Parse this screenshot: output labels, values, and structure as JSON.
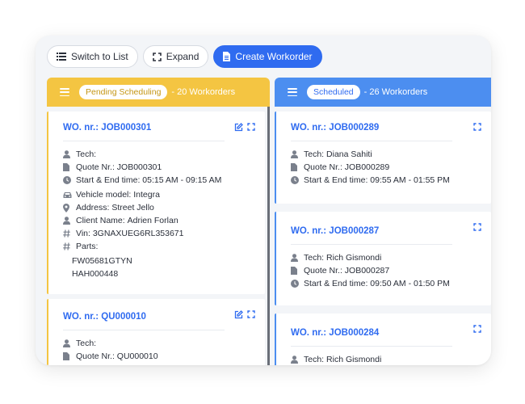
{
  "toolbar": {
    "switch_label": "Switch to List",
    "expand_label": "Expand",
    "create_label": "Create Workorder"
  },
  "columns": [
    {
      "status": "Pending Scheduling",
      "count": "- 20 Workorders",
      "color": "#f4c542",
      "cards": [
        {
          "wo_label": "WO. nr.:",
          "wo_number": "JOB000301",
          "tech": "Tech:",
          "quote": "Quote Nr.: JOB000301",
          "time": "Start & End time: 05:15 AM - 09:15 AM",
          "vehicle_label": "Vehicle model:",
          "vehicle": "Integra",
          "address_label": "Address:",
          "address": "Street Jello",
          "client_label": "Client Name:",
          "client": "Adrien Forlan",
          "vin_label": "Vin:",
          "vin": "3GNAXUEG6RL353671",
          "parts_label": "Parts:",
          "parts": [
            "FW05681GTYN",
            "HAH000448"
          ]
        },
        {
          "wo_label": "WO. nr.:",
          "wo_number": "QU000010",
          "tech": "Tech:",
          "quote": "Quote Nr.: QU000010"
        }
      ]
    },
    {
      "status": "Scheduled",
      "count": "- 26 Workorders",
      "color": "#4c8ef0",
      "cards": [
        {
          "wo_label": "WO. nr.:",
          "wo_number": "JOB000289",
          "tech_label": "Tech:",
          "tech": "Diana Sahiti",
          "quote": "Quote Nr.: JOB000289",
          "time": "Start & End time: 09:55 AM - 01:55 PM"
        },
        {
          "wo_label": "WO. nr.:",
          "wo_number": "JOB000287",
          "tech_label": "Tech:",
          "tech": "Rich Gismondi",
          "quote": "Quote Nr.: JOB000287",
          "time": "Start & End time: 09:50 AM - 01:50 PM"
        },
        {
          "wo_label": "WO. nr.:",
          "wo_number": "JOB000284",
          "tech_label": "Tech:",
          "tech": "Rich Gismondi"
        }
      ]
    }
  ],
  "colors": {
    "accent": "#2f6bf0",
    "pending": "#f4c542",
    "scheduled": "#4c8ef0"
  }
}
